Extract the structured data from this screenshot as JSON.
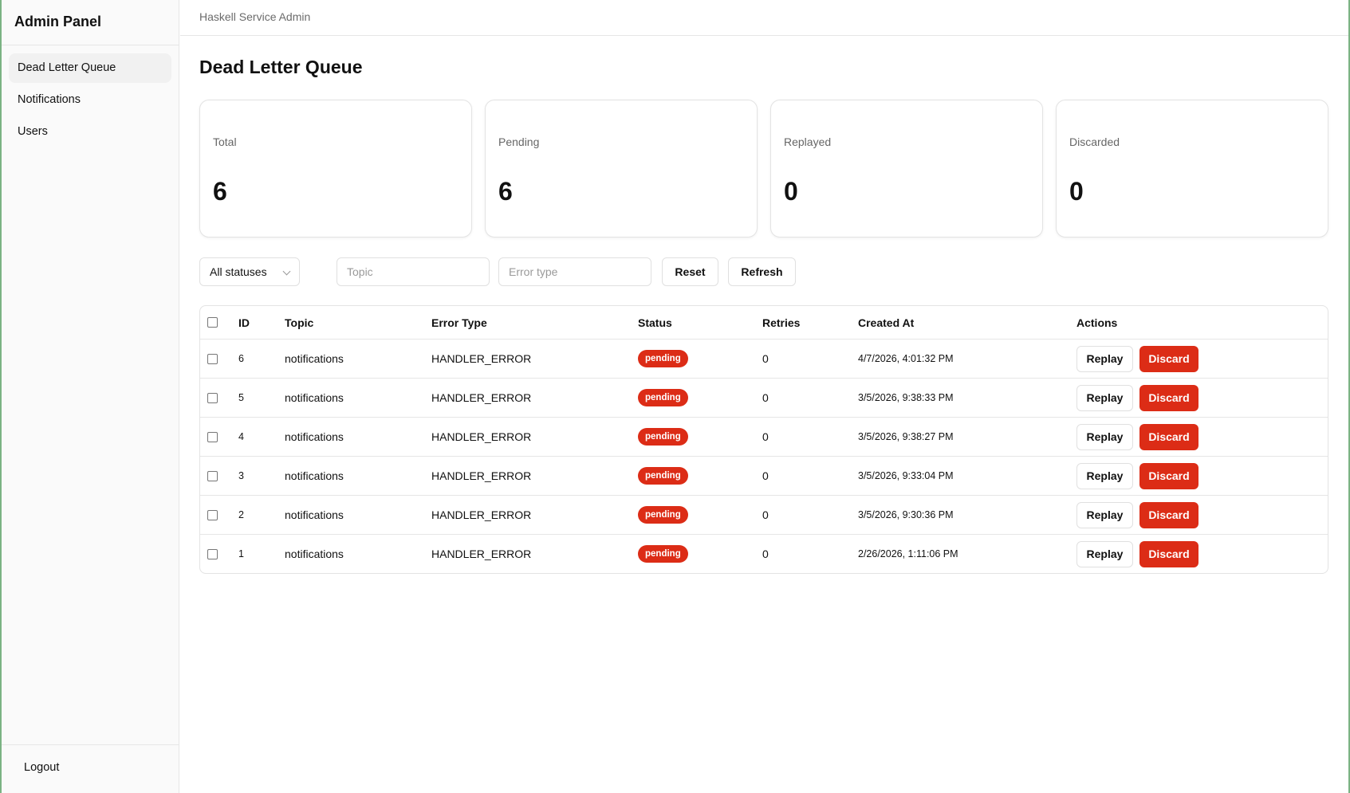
{
  "app": {
    "title": "Admin Panel",
    "topbar_text": "Haskell Service Admin"
  },
  "sidebar": {
    "items": [
      {
        "label": "Dead Letter Queue",
        "active": true
      },
      {
        "label": "Notifications",
        "active": false
      },
      {
        "label": "Users",
        "active": false
      }
    ],
    "logout_label": "Logout"
  },
  "page": {
    "title": "Dead Letter Queue"
  },
  "stats": [
    {
      "label": "Total",
      "value": "6"
    },
    {
      "label": "Pending",
      "value": "6"
    },
    {
      "label": "Replayed",
      "value": "0"
    },
    {
      "label": "Discarded",
      "value": "0"
    }
  ],
  "filters": {
    "status_selected": "All statuses",
    "topic_placeholder": "Topic",
    "error_type_placeholder": "Error type",
    "reset_label": "Reset",
    "refresh_label": "Refresh"
  },
  "table": {
    "headers": {
      "id": "ID",
      "topic": "Topic",
      "error_type": "Error Type",
      "status": "Status",
      "retries": "Retries",
      "created_at": "Created At",
      "actions": "Actions"
    },
    "replay_label": "Replay",
    "discard_label": "Discard",
    "rows": [
      {
        "id": "6",
        "topic": "notifications",
        "error_type": "HANDLER_ERROR",
        "status": "pending",
        "retries": "0",
        "created_at": "4/7/2026, 4:01:32 PM"
      },
      {
        "id": "5",
        "topic": "notifications",
        "error_type": "HANDLER_ERROR",
        "status": "pending",
        "retries": "0",
        "created_at": "3/5/2026, 9:38:33 PM"
      },
      {
        "id": "4",
        "topic": "notifications",
        "error_type": "HANDLER_ERROR",
        "status": "pending",
        "retries": "0",
        "created_at": "3/5/2026, 9:38:27 PM"
      },
      {
        "id": "3",
        "topic": "notifications",
        "error_type": "HANDLER_ERROR",
        "status": "pending",
        "retries": "0",
        "created_at": "3/5/2026, 9:33:04 PM"
      },
      {
        "id": "2",
        "topic": "notifications",
        "error_type": "HANDLER_ERROR",
        "status": "pending",
        "retries": "0",
        "created_at": "3/5/2026, 9:30:36 PM"
      },
      {
        "id": "1",
        "topic": "notifications",
        "error_type": "HANDLER_ERROR",
        "status": "pending",
        "retries": "0",
        "created_at": "2/26/2026, 1:11:06 PM"
      }
    ]
  },
  "colors": {
    "danger": "#dc2c16",
    "sidebar_bg": "#fafafa",
    "border": "#e6e6e6",
    "frame": "#7bb383"
  }
}
